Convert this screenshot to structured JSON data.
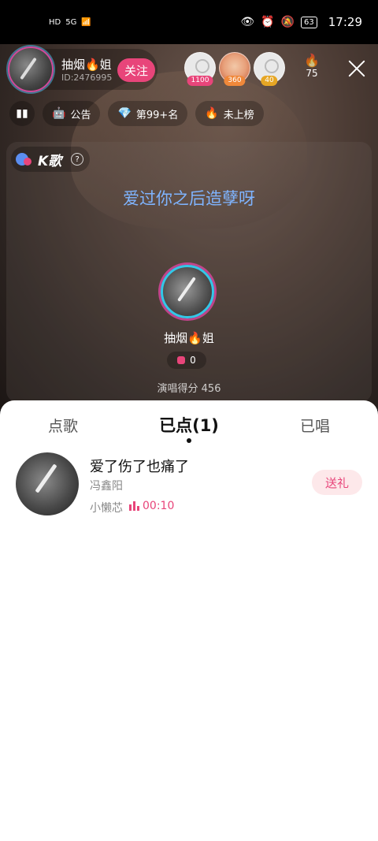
{
  "status_bar": {
    "network_left": "HD",
    "signal_label": "5G",
    "battery": "63",
    "time": "17:29"
  },
  "host": {
    "name": "抽烟🔥姐",
    "id": "ID:2476995",
    "follow_label": "关注"
  },
  "viewers": [
    {
      "badge": "1100",
      "badge_color": "#e8457a"
    },
    {
      "badge": "360",
      "badge_color": "#f0883a"
    },
    {
      "badge": "40",
      "badge_color": "#e6a624"
    }
  ],
  "heat": {
    "value": "75"
  },
  "chips": {
    "notice_label": "公告",
    "rank_label": "第99+名",
    "list_label": "未上榜"
  },
  "ksong": {
    "label": "K歌",
    "lyric": "爱过你之后造孽呀",
    "singer_name": "抽烟🔥姐",
    "gift_count": "0",
    "score_text": "演唱得分 456"
  },
  "sheet": {
    "tabs": [
      {
        "label": "点歌"
      },
      {
        "label": "已点(1)"
      },
      {
        "label": "已唱"
      }
    ],
    "song": {
      "title": "爱了伤了也痛了",
      "artist": "冯鑫阳",
      "user": "小懒芯",
      "time": "00:10",
      "gift_label": "送礼"
    }
  },
  "colors": {
    "accent": "#e8457a",
    "lyric": "#7fb4ff"
  }
}
